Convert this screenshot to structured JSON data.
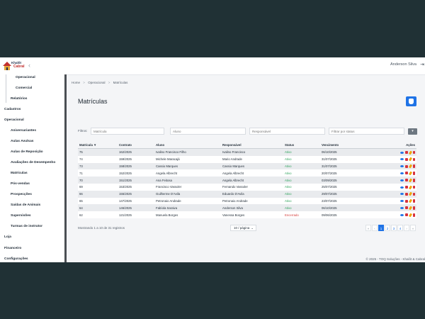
{
  "header": {
    "brand_line1": "Khalôt",
    "brand_line2": "Cabral",
    "user_name": "Anderson Silva",
    "logout_glyph": "⇥"
  },
  "sidebar": {
    "items": [
      {
        "label": "Operacional"
      },
      {
        "label": "Comercial"
      },
      {
        "label": "Relatórios"
      },
      {
        "label": "Cadastros"
      },
      {
        "label": "Operacional"
      },
      {
        "label": "Aniversariantes"
      },
      {
        "label": "Aulas Avulsas"
      },
      {
        "label": "Aulas de Reposição"
      },
      {
        "label": "Avaliações de Desempenho"
      },
      {
        "label": "Matrículas"
      },
      {
        "label": "Pós-vendas"
      },
      {
        "label": "Prospecções"
      },
      {
        "label": "Saídas de Animais"
      },
      {
        "label": "Supervisões"
      },
      {
        "label": "Turmas de instrutor"
      },
      {
        "label": "Loja"
      },
      {
        "label": "Financeiro"
      },
      {
        "label": "Configurações"
      }
    ]
  },
  "breadcrumb": {
    "home": "Home",
    "section": "Operacional",
    "current": "Matrículas",
    "sep": ">"
  },
  "page": {
    "title": "Matrículas",
    "filters_label": "Filtros:",
    "filters": {
      "matricula_placeholder": "Matrícula",
      "aluno_placeholder": "Aluno",
      "responsavel_placeholder": "Responsável",
      "status_placeholder": "Filtrar por status"
    }
  },
  "table": {
    "columns": [
      "Matrícula ▼",
      "Contrato",
      "Aluno",
      "Responsável",
      "Status",
      "Vencimento",
      "Ações"
    ],
    "rows": [
      [
        "75",
        "162/2025",
        "Ivalino Francisco Filho",
        "Ivalino Francisco",
        "Ativo",
        "06/10/2025"
      ],
      [
        "74",
        "159/2025",
        "Michele Maracajá",
        "Mario Andrade",
        "Ativo",
        "31/07/2025"
      ],
      [
        "73",
        "158/2025",
        "Cassio Marques",
        "Cassio Marques",
        "Ativo",
        "31/07/2025"
      ],
      [
        "71",
        "152/2025",
        "Angela Albrecht",
        "Angela Albrecht",
        "Ativo",
        "20/07/2025"
      ],
      [
        "70",
        "151/2025",
        "Ana Feitosa",
        "Angela Albrecht",
        "Ativo",
        "03/09/2025"
      ],
      [
        "69",
        "153/2025",
        "Francisco Vassoler",
        "Fernando Vassoler",
        "Ativo",
        "25/07/2025"
      ],
      [
        "66",
        "155/2025",
        "Guilherme D'Avila",
        "Eduardo D'Avila",
        "Ativo",
        "29/07/2025"
      ],
      [
        "65",
        "147/2025",
        "Petronaio Andrade",
        "Petronaio Andrade",
        "Ativo",
        "23/07/2025"
      ],
      [
        "64",
        "146/2025",
        "Fabíola Saraiva",
        "Anderson Silva",
        "Ativo",
        "06/10/2025"
      ],
      [
        "62",
        "121/2025",
        "Manuela Borges",
        "Vanessa Borges",
        "Encerrado",
        "09/06/2025"
      ]
    ]
  },
  "pagination": {
    "summary": "Mostrando 1 a 10 de 31 registros",
    "per_page": "10 / página",
    "pages": [
      "1",
      "2",
      "3",
      "4"
    ],
    "first": "«",
    "prev": "‹",
    "next": "›",
    "last": "»"
  },
  "footer": {
    "text": "© 2025 - TOQ Soluções - Khalôt & Cabral"
  },
  "colors": {
    "primary": "#1f73e6",
    "active_status": "#2fa35d",
    "closed_status": "#d6403f",
    "backdrop": "#203135"
  },
  "icons": {
    "row_actions": [
      "eye-icon",
      "lock-icon",
      "pencil-icon",
      "trash-icon"
    ],
    "add_button": "id-badge-icon",
    "filter_button": "filter-icon"
  }
}
